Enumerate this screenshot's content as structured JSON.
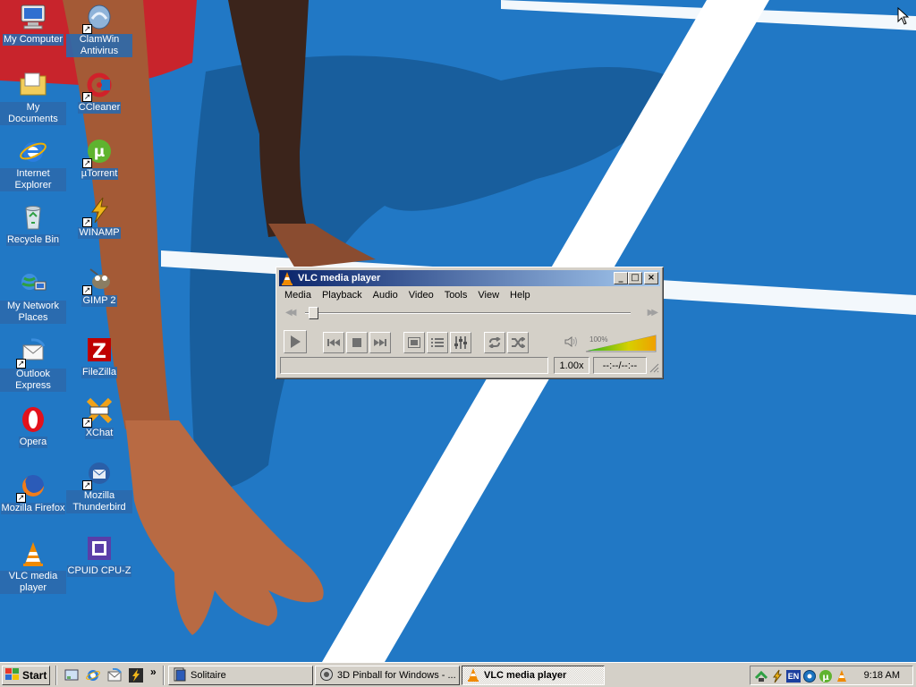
{
  "desktop": {
    "icons": [
      {
        "label": "My Computer",
        "icon": "my-computer-icon"
      },
      {
        "label": "My Documents",
        "icon": "my-documents-icon"
      },
      {
        "label": "Internet Explorer",
        "icon": "internet-explorer-icon"
      },
      {
        "label": "Recycle Bin",
        "icon": "recycle-bin-icon"
      },
      {
        "label": "My Network Places",
        "icon": "network-places-icon"
      },
      {
        "label": "Outlook Express",
        "icon": "outlook-express-icon"
      },
      {
        "label": "Opera",
        "icon": "opera-icon"
      },
      {
        "label": "Mozilla Firefox",
        "icon": "firefox-icon"
      },
      {
        "label": "VLC media player",
        "icon": "vlc-cone-icon"
      },
      {
        "label": "ClamWin Antivirus",
        "icon": "clamwin-icon"
      },
      {
        "label": "CCleaner",
        "icon": "ccleaner-icon"
      },
      {
        "label": "µTorrent",
        "icon": "utorrent-icon"
      },
      {
        "label": "WINAMP",
        "icon": "winamp-icon"
      },
      {
        "label": "GIMP 2",
        "icon": "gimp-icon"
      },
      {
        "label": "FileZilla",
        "icon": "filezilla-icon"
      },
      {
        "label": "XChat",
        "icon": "xchat-icon"
      },
      {
        "label": "Mozilla Thunderbird",
        "icon": "thunderbird-icon"
      },
      {
        "label": "CPUID CPU-Z",
        "icon": "cpuz-icon"
      }
    ]
  },
  "vlc": {
    "title": "VLC media player",
    "menu": [
      "Media",
      "Playback",
      "Audio",
      "Video",
      "Tools",
      "View",
      "Help"
    ],
    "seek_position": 0.0,
    "volume_label": "100%",
    "volume_level": 1.0,
    "speed": "1.00x",
    "time": "--:--/--:--",
    "status_text": ""
  },
  "taskbar": {
    "start_label": "Start",
    "tasks": [
      {
        "label": "Solitaire",
        "icon": "solitaire-icon",
        "active": false
      },
      {
        "label": "3D Pinball for Windows - ...",
        "icon": "pinball-icon",
        "active": false
      },
      {
        "label": "VLC media player",
        "icon": "vlc-cone-icon",
        "active": true
      }
    ],
    "tray": {
      "language": "EN",
      "clock": "9:18 AM"
    }
  },
  "colors": {
    "desktop_blue": "#1d74c0",
    "title_gradient_start": "#0a246a",
    "title_gradient_end": "#a6caf0",
    "face": "#d4d0c8"
  }
}
